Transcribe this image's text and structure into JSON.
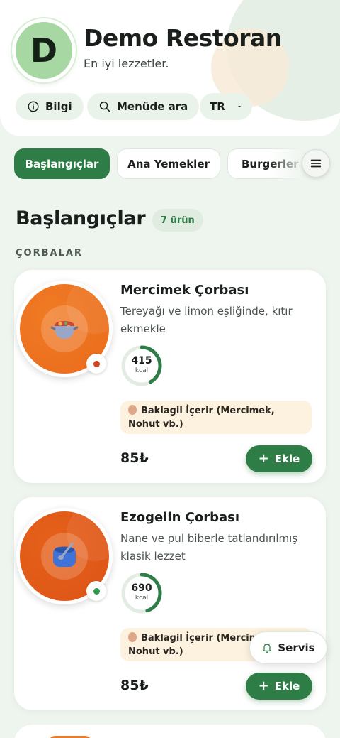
{
  "restaurant": {
    "initial": "D",
    "name": "Demo Restoran",
    "tagline": "En iyi lezzetler."
  },
  "header_actions": {
    "info_label": "Bilgi",
    "search_label": "Menüde ara",
    "language": "TR"
  },
  "categories": [
    {
      "label": "Başlangıçlar",
      "active": true
    },
    {
      "label": "Ana Yemekler",
      "active": false
    },
    {
      "label": "Burgerler",
      "active": false
    }
  ],
  "section": {
    "title": "Başlangıçlar",
    "count": "7 ürün",
    "subsection": "ÇORBALAR"
  },
  "items": [
    {
      "name": "Mercimek Çorbası",
      "description": "Tereyağı ve limon eşliğinde, kıtır ekmekle",
      "kcal": "415",
      "kcal_unit": "kcal",
      "kcal_fraction": 0.42,
      "allergen": "Baklagil İçerir (Mercimek, Nohut vb.)",
      "price": "85₺",
      "add_label": "Ekle",
      "status_color": "#d2451e",
      "plate_colors": [
        "#f07a24",
        "#ea6c1c"
      ],
      "icon": "soup-pot-icon"
    },
    {
      "name": "Ezogelin Çorbası",
      "description": "Nane ve pul biberle tatlandırılmış klasik lezzet",
      "kcal": "690",
      "kcal_unit": "kcal",
      "kcal_fraction": 0.45,
      "allergen": "Baklagil İçerir (Mercimek, Nohut vb.)",
      "price": "85₺",
      "add_label": "Ekle",
      "status_color": "#2e9a4e",
      "plate_colors": [
        "#e5611a",
        "#dd5416"
      ],
      "icon": "soup-bowl-icon"
    }
  ],
  "service_button": {
    "label": "Servis",
    "icon": "bell-icon"
  },
  "colors": {
    "accent": "#2e7d46",
    "background": "#eef4ee",
    "allergen_bg": "#fdf1df"
  }
}
